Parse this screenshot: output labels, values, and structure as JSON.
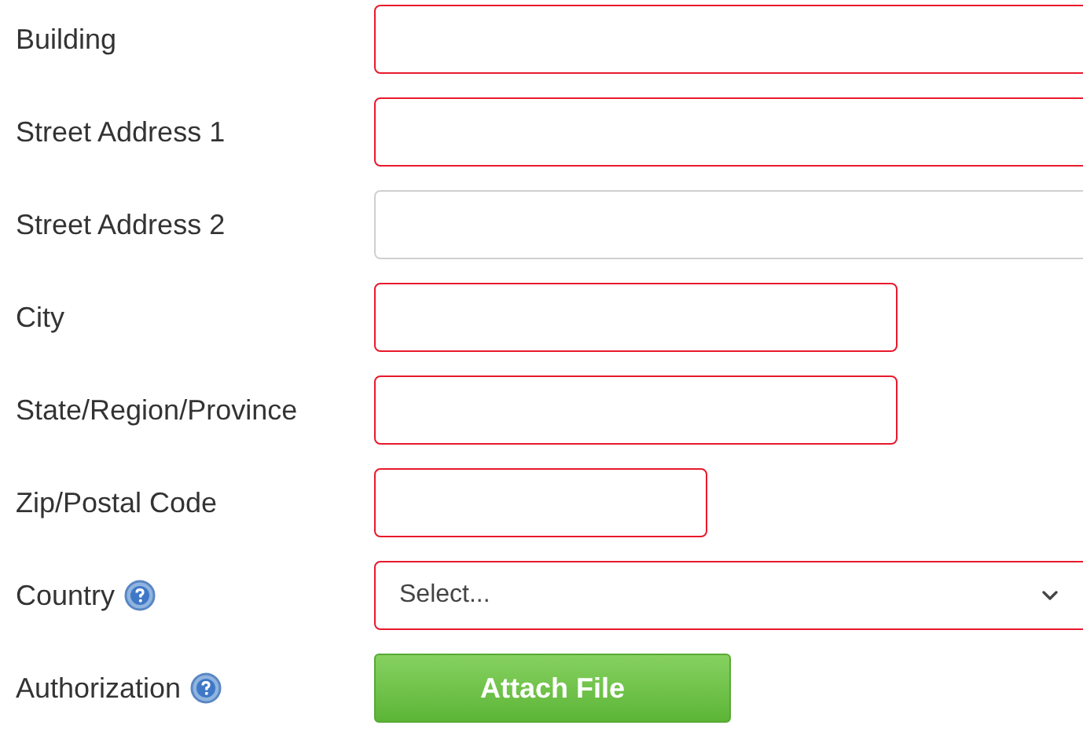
{
  "fields": [
    {
      "label": "Building",
      "kind": "text",
      "invalid": true,
      "help": false
    },
    {
      "label": "Street Address 1",
      "kind": "text",
      "invalid": true,
      "help": false
    },
    {
      "label": "Street Address 2",
      "kind": "text",
      "invalid": false,
      "help": false
    },
    {
      "label": "City",
      "kind": "text",
      "invalid": true,
      "help": false
    },
    {
      "label": "State/Region/Province",
      "kind": "text",
      "invalid": true,
      "help": false
    },
    {
      "label": "Zip/Postal Code",
      "kind": "text",
      "invalid": true,
      "help": false
    },
    {
      "label": "Country",
      "kind": "select",
      "invalid": true,
      "help": true,
      "placeholder": "Select..."
    },
    {
      "label": "Authorization",
      "kind": "file",
      "help": true,
      "button": "Attach File"
    }
  ]
}
